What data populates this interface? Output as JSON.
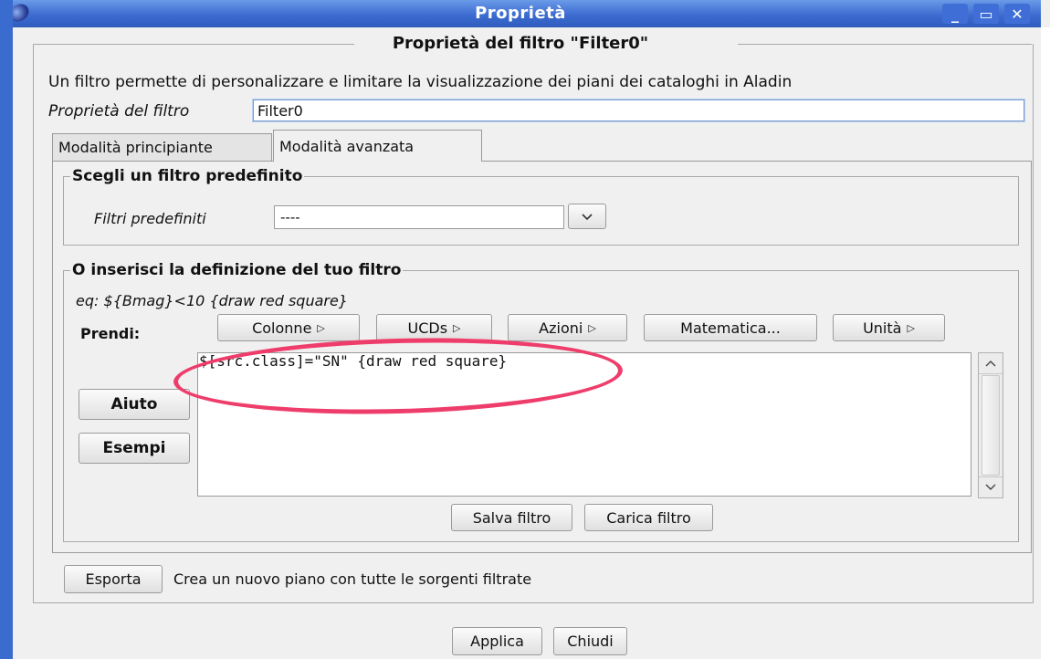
{
  "window": {
    "title": "Proprietà",
    "heading": "Proprietà del filtro \"Filter0\"",
    "controls": {
      "minimize": "_",
      "maximize": "▭",
      "close": "✕"
    }
  },
  "description": "Un filtro permette di personalizzare e limitare la visualizzazione dei piani dei cataloghi in Aladin",
  "filter_name": {
    "label": "Proprietà del filtro",
    "value": "Filter0"
  },
  "tabs": [
    {
      "label": "Modalità principiante",
      "active": false
    },
    {
      "label": "Modalità avanzata",
      "active": true
    }
  ],
  "predefined": {
    "group_title": "Scegli un filtro predefinito",
    "label": "Filtri predefiniti",
    "value": "----"
  },
  "custom": {
    "group_title": "O inserisci la definizione del tuo filtro",
    "example": "eq: ${Bmag}<10 {draw red square}",
    "prendi_label": "Prendi:",
    "buttons": {
      "colonne": "Colonne",
      "ucds": "UCDs",
      "azioni": "Azioni",
      "matematica": "Matematica...",
      "unita": "Unità"
    },
    "submenu_arrow": "▷",
    "aiuto": "Aiuto",
    "esempi": "Esempi",
    "definition": "$[src.class]=\"SN\" {draw red square}",
    "salva": "Salva filtro",
    "carica": "Carica filtro"
  },
  "export": {
    "button": "Esporta",
    "text": "Crea un nuovo piano con tutte le sorgenti filtrate"
  },
  "footer": {
    "applica": "Applica",
    "chiudi": "Chiudi"
  },
  "colors": {
    "titlebar": "#3c6cd0",
    "highlight": "#ee3d6b"
  }
}
